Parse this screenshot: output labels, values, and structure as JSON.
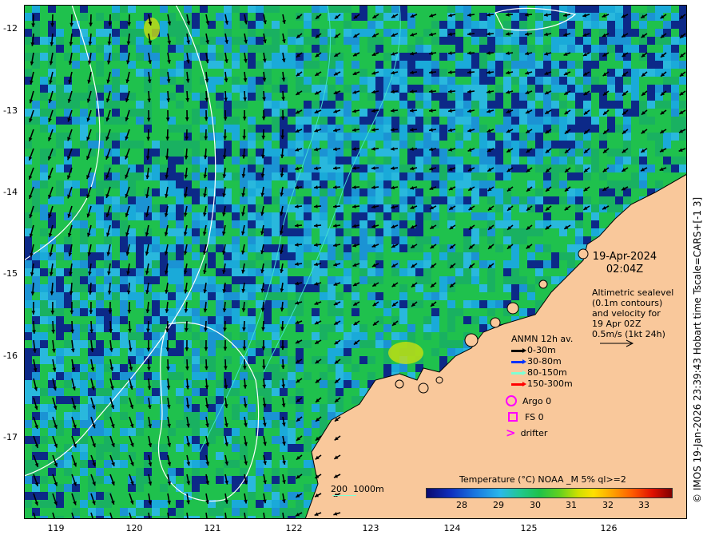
{
  "map": {
    "lon_ticks": [
      "119",
      "120",
      "121",
      "122",
      "123",
      "124",
      "125",
      "126"
    ],
    "lat_ticks": [
      "-12",
      "-13",
      "-14",
      "-15",
      "-16",
      "-17"
    ],
    "date": "19-Apr-2024",
    "time": "02:04Z",
    "altimetry_lines": [
      "Altimetric sealevel",
      "(0.1m contours)",
      "and velocity for",
      "19 Apr 02Z",
      "0.5m/s (1kt 24h)"
    ],
    "anmn_title": "ANMN 12h av.",
    "anmn_layers": [
      {
        "label": "0-30m",
        "color": "#000000"
      },
      {
        "label": "30-80m",
        "color": "#0033ff"
      },
      {
        "label": "80-150m",
        "color": "#7fffd4"
      },
      {
        "label": "150-300m",
        "color": "#ff0000"
      }
    ],
    "argo_label": "Argo 0",
    "fs_label": "FS 0",
    "drifter_label": "drifter",
    "colorbar_title": "Temperature (°C) NOAA _M 5% ql>=2",
    "colorbar_ticks": [
      "28",
      "29",
      "30",
      "31",
      "32",
      "33"
    ],
    "scale_label": "200  1000m",
    "credit": "© IMOS 19-Jan-2026 23:39:43 Hobart time Tscale=CARS+[-1 3]",
    "colors": {
      "land": "#f9c89b",
      "sst_cool": "#0a1a8c",
      "sst_mid": "#1aa8e6",
      "sst_warm": "#1fc24a",
      "contour": "#ffffff",
      "isobath": "#40e0d0"
    }
  }
}
